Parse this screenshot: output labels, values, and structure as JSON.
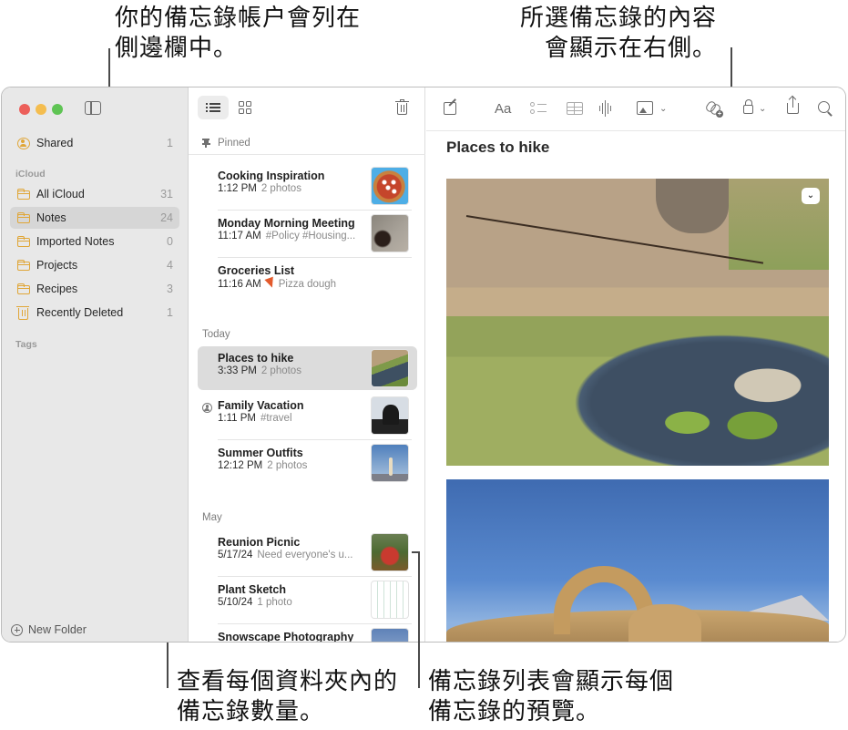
{
  "callouts": {
    "top_left": [
      "你的備忘錄帳户會列在",
      "側邊欄中。"
    ],
    "top_right": [
      "所選備忘錄的內容",
      "會顯示在右側。"
    ],
    "bottom_left": [
      "查看每個資料夾內的",
      "備忘錄數量。"
    ],
    "bottom_right": [
      "備忘錄列表會顯示每個",
      "備忘錄的預覽。"
    ]
  },
  "sidebar": {
    "shared": {
      "label": "Shared",
      "count": "1",
      "icon": "person-circle-icon"
    },
    "section_icloud": "iCloud",
    "folders": [
      {
        "label": "All iCloud",
        "count": "31",
        "icon": "folder-icon",
        "selected": false
      },
      {
        "label": "Notes",
        "count": "24",
        "icon": "folder-icon",
        "selected": true
      },
      {
        "label": "Imported Notes",
        "count": "0",
        "icon": "folder-icon",
        "selected": false
      },
      {
        "label": "Projects",
        "count": "4",
        "icon": "folder-icon",
        "selected": false
      },
      {
        "label": "Recipes",
        "count": "3",
        "icon": "folder-icon",
        "selected": false
      },
      {
        "label": "Recently Deleted",
        "count": "1",
        "icon": "trash-icon",
        "selected": false
      }
    ],
    "section_tags": "Tags",
    "new_folder_label": "New Folder",
    "accent_color": "#e0a637"
  },
  "notelist": {
    "groups": [
      {
        "heading": "Pinned",
        "notes": [
          {
            "title": "Cooking Inspiration",
            "time": "1:12 PM",
            "preview": "2 photos",
            "thumb": "pizza"
          },
          {
            "title": "Monday Morning Meeting",
            "time": "11:17 AM",
            "preview": "#Policy #Housing...",
            "thumb": "meeting"
          },
          {
            "title": "Groceries List",
            "time": "11:16 AM",
            "preview": "Pizza dough",
            "preview_icon": "pizza-emoji"
          }
        ]
      },
      {
        "heading": "Today",
        "notes": [
          {
            "title": "Places to hike",
            "time": "3:33 PM",
            "preview": "2 photos",
            "thumb": "hike",
            "selected": true
          },
          {
            "title": "Family Vacation",
            "time": "1:11 PM",
            "preview": "#travel",
            "thumb": "family",
            "shared": true
          },
          {
            "title": "Summer Outfits",
            "time": "12:12 PM",
            "preview": "2 photos",
            "thumb": "outfits"
          }
        ]
      },
      {
        "heading": "May",
        "notes": [
          {
            "title": "Reunion Picnic",
            "time": "5/17/24",
            "preview": "Need everyone's u...",
            "thumb": "picnic"
          },
          {
            "title": "Plant Sketch",
            "time": "5/10/24",
            "preview": "1 photo",
            "thumb": "plant"
          },
          {
            "title": "Snowscape Photography",
            "time": "",
            "preview": "",
            "thumb": "snow"
          }
        ]
      }
    ]
  },
  "editor": {
    "toolbar": {
      "format_label": "Aa"
    },
    "note_title": "Places to hike",
    "photos": [
      "hot-springs-creek-photo",
      "rock-arch-photo"
    ]
  }
}
